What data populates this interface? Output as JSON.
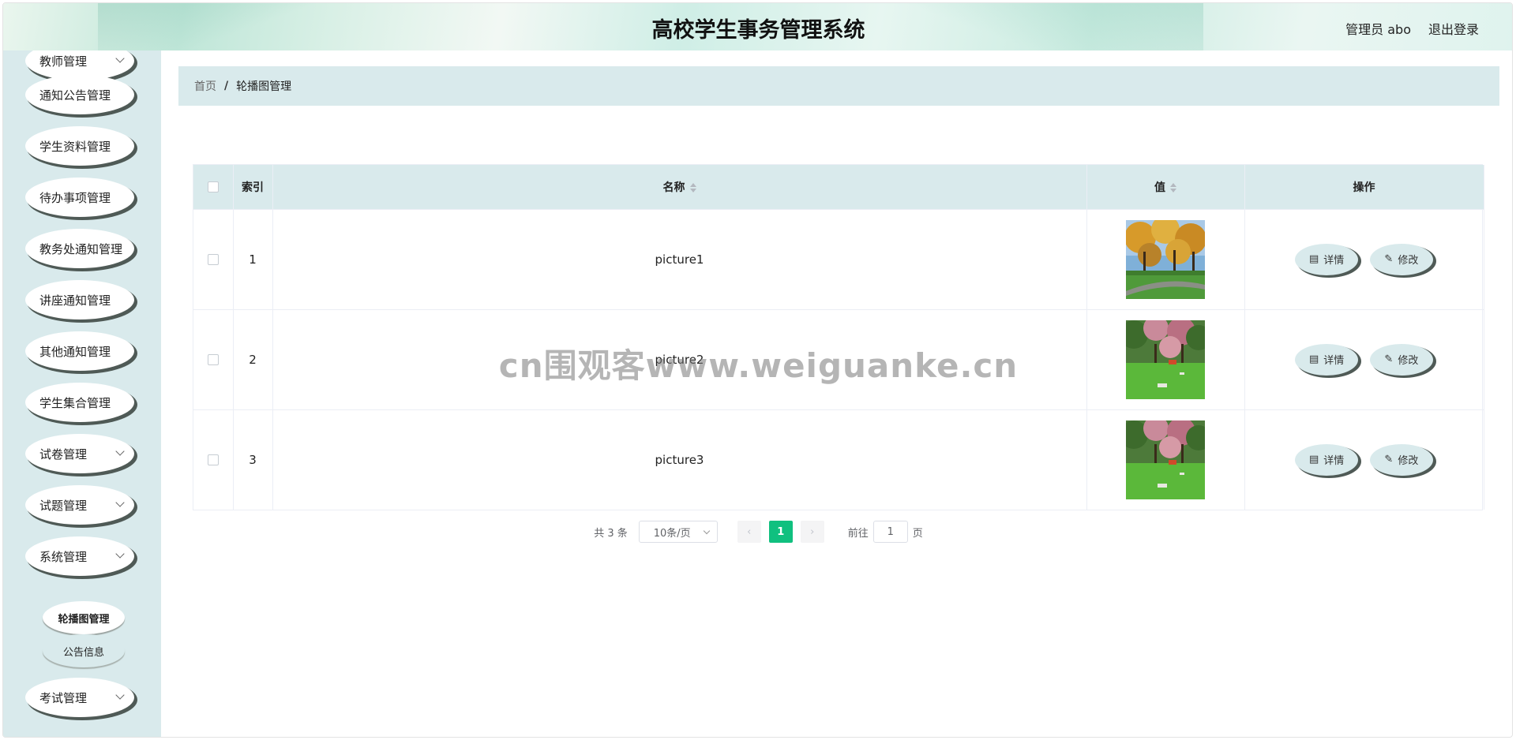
{
  "header": {
    "title": "高校学生事务管理系统",
    "user": "管理员 abo",
    "logout": "退出登录"
  },
  "sidebar": {
    "items": [
      {
        "label": "教师管理",
        "chevron": true
      },
      {
        "label": "通知公告管理",
        "chevron": false
      },
      {
        "label": "学生资料管理",
        "chevron": false
      },
      {
        "label": "待办事项管理",
        "chevron": false
      },
      {
        "label": "教务处通知管理",
        "chevron": false
      },
      {
        "label": "讲座通知管理",
        "chevron": false
      },
      {
        "label": "其他通知管理",
        "chevron": false
      },
      {
        "label": "学生集合管理",
        "chevron": false
      },
      {
        "label": "试卷管理",
        "chevron": true
      },
      {
        "label": "试题管理",
        "chevron": true
      },
      {
        "label": "系统管理",
        "chevron": true
      },
      {
        "label": "考试管理",
        "chevron": true
      }
    ],
    "sub_items": [
      {
        "label": "轮播图管理",
        "active": true
      },
      {
        "label": "公告信息",
        "active": false
      }
    ]
  },
  "breadcrumb": {
    "home": "首页",
    "separator": "/",
    "current": "轮播图管理"
  },
  "table": {
    "columns": {
      "index": "索引",
      "name": "名称",
      "value": "值",
      "actions": "操作"
    },
    "rows": [
      {
        "index": "1",
        "name": "picture1",
        "image": "autumn-park"
      },
      {
        "index": "2",
        "name": "picture2",
        "image": "spring-garden"
      },
      {
        "index": "3",
        "name": "picture3",
        "image": "spring-garden"
      }
    ],
    "actions": {
      "detail": "详情",
      "edit": "修改"
    }
  },
  "pagination": {
    "total": "共 3 条",
    "page_size": "10条/页",
    "current_page": "1",
    "goto_label": "前往",
    "goto_value": "1",
    "page_suffix": "页"
  },
  "watermark": "cn围观客www.weiguanke.cn",
  "colors": {
    "panel": "#d9eaec",
    "accent": "#10c07f",
    "shadow": "#4f5a56"
  }
}
